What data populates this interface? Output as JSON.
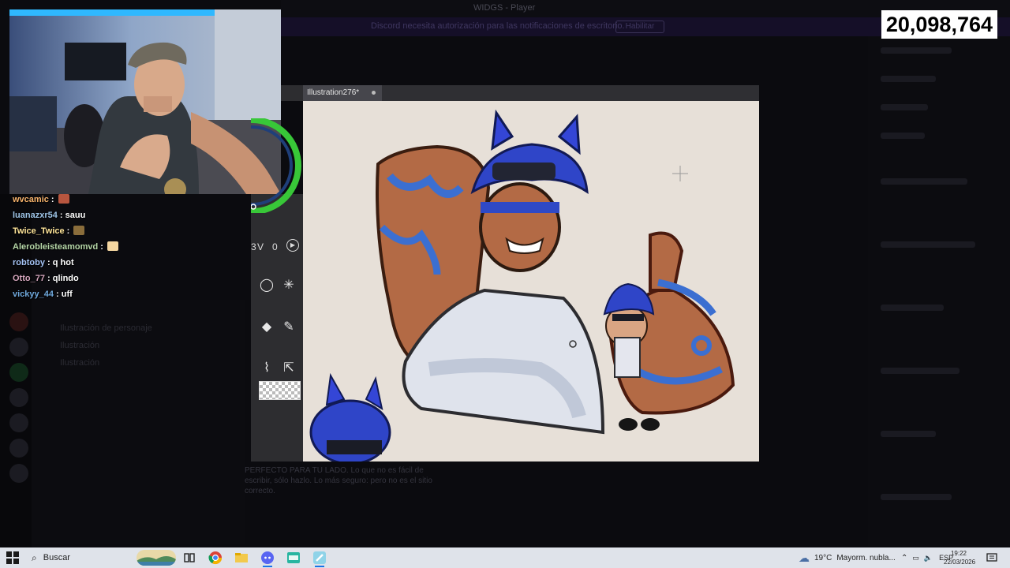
{
  "background_app": {
    "window_title": "WIDGS - Player",
    "banner_text": "Discord necesita autorización para las notificaciones de escritorio.",
    "banner_button": "Habilitar",
    "sidebar_items": [
      "Ilustración de personaje",
      "Ilustración",
      "Ilustración"
    ],
    "bottom_text": "PERFECTO PARA TU LADO. Lo que no es fácil de escribir, sólo hazlo. Lo más seguro: pero no es el sitio correcto."
  },
  "viewer_count": "20,098,764",
  "chat": {
    "messages": [
      {
        "user": "wvcamic",
        "text": "",
        "color": "#f6b26b",
        "emote": "#b8563f"
      },
      {
        "user": "luanazxr54",
        "text": "sauu",
        "color": "#9fc5e8",
        "emote": null
      },
      {
        "user": "Twice_Twice",
        "text": "",
        "color": "#ffe599",
        "emote": "#8a6d3b"
      },
      {
        "user": "Alerobleisteamomvd",
        "text": "",
        "color": "#b6d7a8",
        "emote": "#f5d7a1"
      },
      {
        "user": "robtoby",
        "text": "q hot",
        "color": "#a4c2f4",
        "emote": null
      },
      {
        "user": "Otto_77",
        "text": "qlindo",
        "color": "#d5a6bd",
        "emote": null
      },
      {
        "user": "vickyy_44",
        "text": "uff",
        "color": "#6fa8dc",
        "emote": null
      }
    ],
    "separator": " : "
  },
  "drawing_app": {
    "canvas_tab": "Illustration276*",
    "numbers": {
      "left": "3",
      "v": "V",
      "right": "0"
    },
    "tools": [
      "lasso-icon",
      "magic-wand-icon",
      "eraser-icon",
      "pen-icon",
      "curve-icon",
      "select-arrow-icon"
    ],
    "accent_green": "#38c738",
    "canvas_bg": "#e7e0d8"
  },
  "taskbar": {
    "search_placeholder": "Buscar",
    "weather_temp": "19°C",
    "weather_text": "Mayorm. nubla...",
    "language": "ESP",
    "time": "19:22",
    "date": "22/03/2026"
  }
}
